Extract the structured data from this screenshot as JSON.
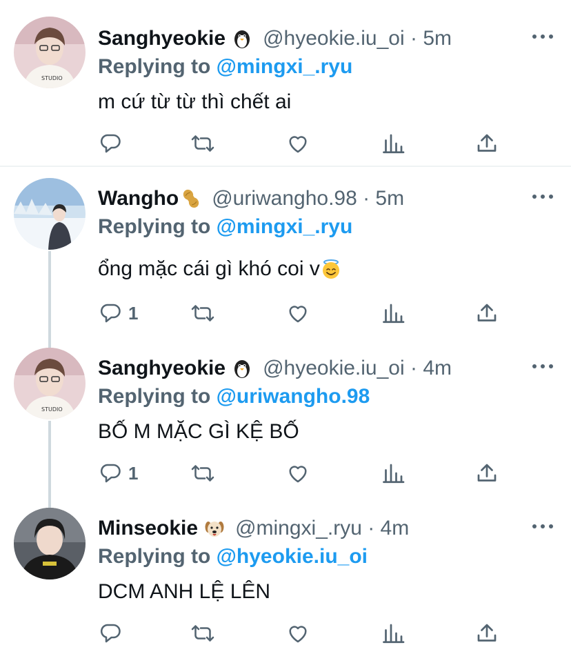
{
  "colors": {
    "accent": "#1d9bf0",
    "secondary": "#536471",
    "text": "#0f1419",
    "thread_line": "#cfd9de"
  },
  "tweets": [
    {
      "name": "Sanghyeokie",
      "badge_icon": "penguin-emoji",
      "handle": "@hyeokie.iu_oi · 5m",
      "replying_prefix": "Replying to ",
      "replying_to": "@mingxi_.ryu",
      "text": "m cứ từ từ thì chết ai",
      "reply_count": ""
    },
    {
      "name": "Wangho",
      "badge_icon": "peanut-emoji",
      "handle": "@uriwangho.98 · 5m",
      "replying_prefix": "Replying to ",
      "replying_to": "@mingxi_.ryu",
      "text": "ổng mặc cái gì khó coi v",
      "text_emoji": "halo-smile-emoji",
      "reply_count": "1"
    },
    {
      "name": "Sanghyeokie",
      "badge_icon": "penguin-emoji",
      "handle": "@hyeokie.iu_oi · 4m",
      "replying_prefix": "Replying to ",
      "replying_to": "@uriwangho.98",
      "text": "BỐ M MẶC GÌ KỆ BỐ",
      "reply_count": "1"
    },
    {
      "name": "Minseokie",
      "badge_icon": "dog-emoji",
      "handle": "@mingxi_.ryu · 4m",
      "replying_prefix": "Replying to ",
      "replying_to": "@hyeokie.iu_oi",
      "text": "DCM ANH LỆ LÊN",
      "reply_count": ""
    }
  ],
  "action_icons": [
    "reply-icon",
    "retweet-icon",
    "like-icon",
    "analytics-icon",
    "share-icon"
  ]
}
